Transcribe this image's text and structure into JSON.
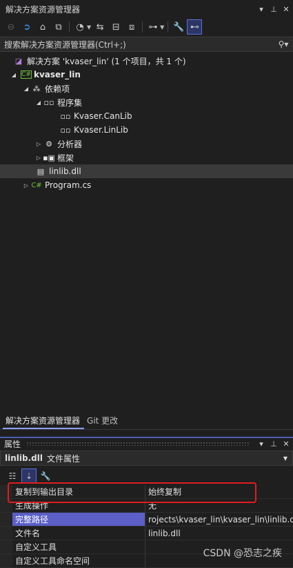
{
  "window": {
    "title": "解决方案资源管理器"
  },
  "window_buttons": [
    "▾",
    "⊥",
    "✕"
  ],
  "search": {
    "placeholder": "搜索解决方案资源管理器(Ctrl+;)"
  },
  "tree": [
    {
      "label": "解决方案 'kvaser_lin' (1 个项目，共 1 个)",
      "icon": "solution-icon",
      "glyph": "◪"
    },
    {
      "label": "kvaser_lin",
      "icon": "csharp-project-icon",
      "glyph": "C#"
    },
    {
      "label": "依赖项",
      "icon": "dependencies-icon",
      "glyph": "⁂"
    },
    {
      "label": "程序集",
      "icon": "assemblies-icon",
      "glyph": "▫▫"
    },
    {
      "label": "Kvaser.CanLib",
      "icon": "assembly-reference-icon",
      "glyph": "▫▫"
    },
    {
      "label": "Kvaser.LinLib",
      "icon": "assembly-reference-icon",
      "glyph": "▫▫"
    },
    {
      "label": "分析器",
      "icon": "analyzers-icon",
      "glyph": "⚙"
    },
    {
      "label": "框架",
      "icon": "framework-icon",
      "glyph": "▪▣"
    },
    {
      "label": "linlib.dll",
      "icon": "dll-file-icon",
      "glyph": "▤"
    },
    {
      "label": "Program.cs",
      "icon": "csharp-file-icon",
      "glyph": "C#"
    }
  ],
  "tabs": [
    "解决方案资源管理器",
    "Git 更改"
  ],
  "properties": {
    "title": "属性",
    "object_name": "linlib.dll",
    "object_type": "文件属性",
    "rows": [
      {
        "name": "复制到输出目录",
        "value": "始终复制"
      },
      {
        "name": "生成操作",
        "value": "无"
      },
      {
        "name": "完整路径",
        "value": "rojects\\kvaser_lin\\kvaser_lin\\linlib.dll"
      },
      {
        "name": "文件名",
        "value": "linlib.dll"
      },
      {
        "name": "自定义工具",
        "value": ""
      },
      {
        "name": "自定义工具命名空间",
        "value": ""
      }
    ]
  },
  "watermark": "CSDN @恐志之疾",
  "colors": {
    "accent": "#5b5fc7",
    "highlight_box": "#e11d1d",
    "csharp": "#6fbf3a"
  }
}
